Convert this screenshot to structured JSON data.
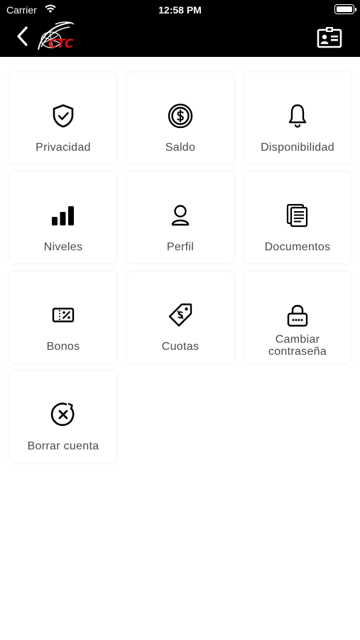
{
  "status_bar": {
    "carrier": "Carrier",
    "time": "12:58 PM"
  },
  "header": {
    "back_icon": "chevron-left-icon",
    "logo_text": "CTC",
    "logo_color": "#e01010",
    "action_icon": "id-card-icon",
    "background": "#000000"
  },
  "menu": {
    "items": [
      {
        "label": "Privacidad",
        "icon": "shield-check-icon"
      },
      {
        "label": "Saldo",
        "icon": "dollar-coin-icon"
      },
      {
        "label": "Disponibilidad",
        "icon": "bell-icon"
      },
      {
        "label": "Niveles",
        "icon": "bar-levels-icon"
      },
      {
        "label": "Perfil",
        "icon": "person-icon"
      },
      {
        "label": "Documentos",
        "icon": "documents-icon"
      },
      {
        "label": "Bonos",
        "icon": "voucher-icon"
      },
      {
        "label": "Cuotas",
        "icon": "price-tag-icon"
      },
      {
        "label": "Cambiar contraseña",
        "icon": "lock-icon"
      },
      {
        "label": "Borrar cuenta",
        "icon": "delete-circle-icon"
      }
    ]
  }
}
